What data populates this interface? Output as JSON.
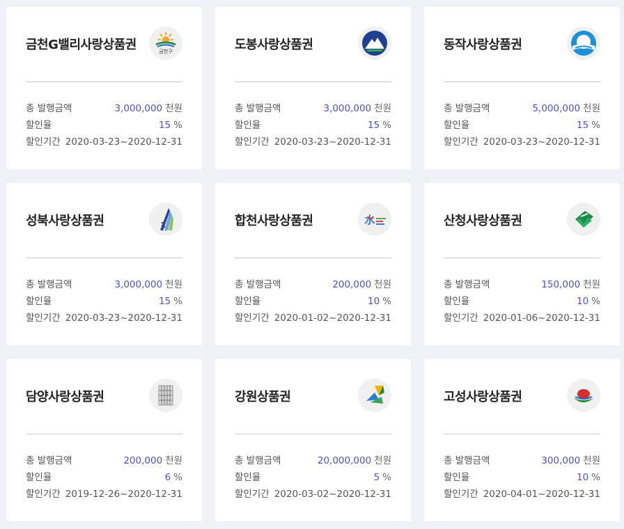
{
  "labels": {
    "total": "총 발행금액",
    "discount": "할인율",
    "period": "할인기간",
    "unit_amount": "천원",
    "unit_percent": "%"
  },
  "cards": [
    {
      "title": "금천G밸리사랑상품권",
      "amount": "3,000,000",
      "rate": "15",
      "period": "2020-03-23~2020-12-31",
      "logo_icon": "geumcheon-logo-icon",
      "logo_text": "금천구"
    },
    {
      "title": "도봉사랑상품권",
      "amount": "3,000,000",
      "rate": "15",
      "period": "2020-03-23~2020-12-31",
      "logo_icon": "dobong-logo-icon"
    },
    {
      "title": "동작사랑상품권",
      "amount": "5,000,000",
      "rate": "15",
      "period": "2020-03-23~2020-12-31",
      "logo_icon": "dongjak-logo-icon"
    },
    {
      "title": "성북사랑상품권",
      "amount": "3,000,000",
      "rate": "15",
      "period": "2020-03-23~2020-12-31",
      "logo_icon": "seongbuk-logo-icon"
    },
    {
      "title": "합천사랑상품권",
      "amount": "200,000",
      "rate": "10",
      "period": "2020-01-02~2020-12-31",
      "logo_icon": "hapcheon-logo-icon",
      "logo_text": "水"
    },
    {
      "title": "산청사랑상품권",
      "amount": "150,000",
      "rate": "10",
      "period": "2020-01-06~2020-12-31",
      "logo_icon": "sancheong-logo-icon"
    },
    {
      "title": "담양사랑상품권",
      "amount": "200,000",
      "rate": "6",
      "period": "2019-12-26~2020-12-31",
      "logo_icon": "damyang-logo-icon"
    },
    {
      "title": "강원상품권",
      "amount": "20,000,000",
      "rate": "5",
      "period": "2020-03-02~2020-12-31",
      "logo_icon": "gangwon-logo-icon"
    },
    {
      "title": "고성사랑상품권",
      "amount": "300,000",
      "rate": "10",
      "period": "2020-04-01~2020-12-31",
      "logo_icon": "goseong-logo-icon"
    }
  ]
}
